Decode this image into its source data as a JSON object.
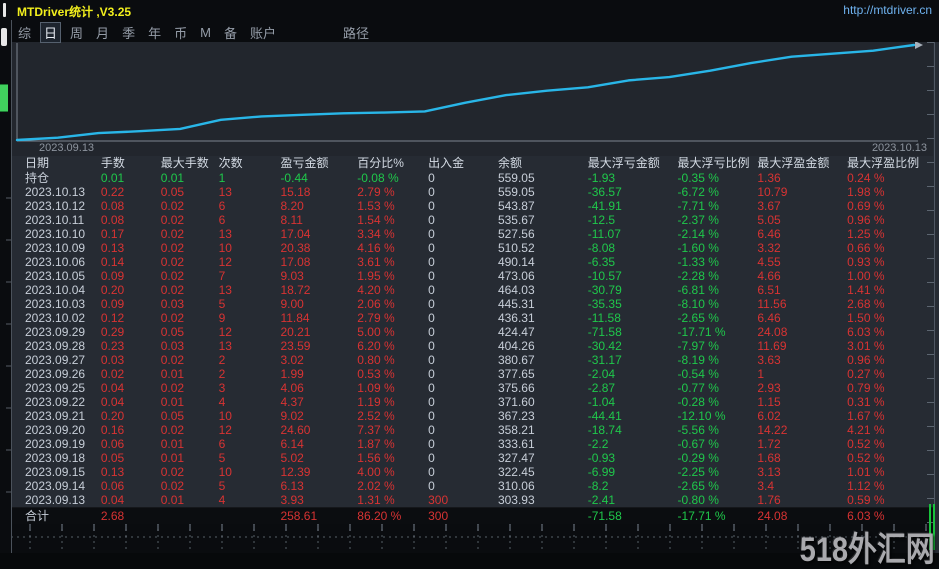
{
  "window": {
    "title": "MTDriver统计 ,V3.25",
    "url": "http://mtdriver.cn",
    "watermark": "518外汇网"
  },
  "menu": {
    "items": [
      "综",
      "日",
      "周",
      "月",
      "季",
      "年",
      "币",
      "M",
      "备",
      "账户"
    ],
    "active": "日",
    "path_label": "路径"
  },
  "palette": {
    "profit_red": "#d83333",
    "loss_green": "#1fc84b",
    "title_yellow": "#f2ef1d",
    "url_blue": "#6fb3f0",
    "line_cyan": "#29b6e8"
  },
  "chart_data": {
    "type": "line",
    "title": "",
    "legend": [],
    "x_start_label": "2023.09.13",
    "x_end_label": "2023.10.13",
    "x": [
      "2023.09.13",
      "2023.09.14",
      "2023.09.15",
      "2023.09.18",
      "2023.09.19",
      "2023.09.20",
      "2023.09.21",
      "2023.09.22",
      "2023.09.25",
      "2023.09.26",
      "2023.09.27",
      "2023.09.28",
      "2023.09.29",
      "2023.10.02",
      "2023.10.03",
      "2023.10.04",
      "2023.10.05",
      "2023.10.06",
      "2023.10.09",
      "2023.10.10",
      "2023.10.11",
      "2023.10.12",
      "2023.10.13"
    ],
    "series": [
      {
        "name": "余额",
        "values": [
          303.93,
          310.06,
          322.45,
          327.47,
          333.61,
          358.21,
          367.23,
          371.6,
          375.66,
          377.65,
          380.67,
          404.26,
          424.47,
          436.31,
          445.31,
          464.03,
          473.06,
          490.14,
          510.52,
          527.56,
          535.67,
          543.87,
          559.05
        ]
      }
    ],
    "ylim": [
      300,
      560
    ],
    "grid": false,
    "line_color": "#29b6e8"
  },
  "table": {
    "headers": [
      "日期",
      "手数",
      "最大手数",
      "次数",
      "盈亏金额",
      "百分比%",
      "出入金",
      "余额",
      "最大浮亏金额",
      "最大浮亏比例",
      "最大浮盈金额",
      "最大浮盈比例"
    ],
    "rows": [
      {
        "holding": true,
        "cells": [
          "持仓",
          "0.01",
          "0.01",
          "1",
          "-0.44",
          "-0.08 %",
          "0",
          "559.05",
          "-1.93",
          "-0.35 %",
          "1.36",
          "0.24 %"
        ]
      },
      {
        "cells": [
          "2023.10.13",
          "0.22",
          "0.05",
          "13",
          "15.18",
          "2.79 %",
          "0",
          "559.05",
          "-36.57",
          "-6.72 %",
          "10.79",
          "1.98 %"
        ]
      },
      {
        "cells": [
          "2023.10.12",
          "0.08",
          "0.02",
          "6",
          "8.20",
          "1.53 %",
          "0",
          "543.87",
          "-41.91",
          "-7.71 %",
          "3.67",
          "0.69 %"
        ]
      },
      {
        "cells": [
          "2023.10.11",
          "0.08",
          "0.02",
          "6",
          "8.11",
          "1.54 %",
          "0",
          "535.67",
          "-12.5",
          "-2.37 %",
          "5.05",
          "0.96 %"
        ]
      },
      {
        "cells": [
          "2023.10.10",
          "0.17",
          "0.02",
          "13",
          "17.04",
          "3.34 %",
          "0",
          "527.56",
          "-11.07",
          "-2.14 %",
          "6.46",
          "1.25 %"
        ]
      },
      {
        "cells": [
          "2023.10.09",
          "0.13",
          "0.02",
          "10",
          "20.38",
          "4.16 %",
          "0",
          "510.52",
          "-8.08",
          "-1.60 %",
          "3.32",
          "0.66 %"
        ]
      },
      {
        "cells": [
          "2023.10.06",
          "0.14",
          "0.02",
          "12",
          "17.08",
          "3.61 %",
          "0",
          "490.14",
          "-6.35",
          "-1.33 %",
          "4.55",
          "0.93 %"
        ]
      },
      {
        "cells": [
          "2023.10.05",
          "0.09",
          "0.02",
          "7",
          "9.03",
          "1.95 %",
          "0",
          "473.06",
          "-10.57",
          "-2.28 %",
          "4.66",
          "1.00 %"
        ]
      },
      {
        "cells": [
          "2023.10.04",
          "0.20",
          "0.02",
          "13",
          "18.72",
          "4.20 %",
          "0",
          "464.03",
          "-30.79",
          "-6.81 %",
          "6.51",
          "1.41 %"
        ]
      },
      {
        "cells": [
          "2023.10.03",
          "0.09",
          "0.03",
          "5",
          "9.00",
          "2.06 %",
          "0",
          "445.31",
          "-35.35",
          "-8.10 %",
          "11.56",
          "2.68 %"
        ]
      },
      {
        "cells": [
          "2023.10.02",
          "0.12",
          "0.02",
          "9",
          "11.84",
          "2.79 %",
          "0",
          "436.31",
          "-11.58",
          "-2.65 %",
          "6.46",
          "1.50 %"
        ]
      },
      {
        "cells": [
          "2023.09.29",
          "0.29",
          "0.05",
          "12",
          "20.21",
          "5.00 %",
          "0",
          "424.47",
          "-71.58",
          "-17.71 %",
          "24.08",
          "6.03 %"
        ]
      },
      {
        "cells": [
          "2023.09.28",
          "0.23",
          "0.03",
          "13",
          "23.59",
          "6.20 %",
          "0",
          "404.26",
          "-30.42",
          "-7.97 %",
          "11.69",
          "3.01 %"
        ]
      },
      {
        "cells": [
          "2023.09.27",
          "0.03",
          "0.02",
          "2",
          "3.02",
          "0.80 %",
          "0",
          "380.67",
          "-31.17",
          "-8.19 %",
          "3.63",
          "0.96 %"
        ]
      },
      {
        "cells": [
          "2023.09.26",
          "0.02",
          "0.01",
          "2",
          "1.99",
          "0.53 %",
          "0",
          "377.65",
          "-2.04",
          "-0.54 %",
          "1",
          "0.27 %"
        ]
      },
      {
        "cells": [
          "2023.09.25",
          "0.04",
          "0.02",
          "3",
          "4.06",
          "1.09 %",
          "0",
          "375.66",
          "-2.87",
          "-0.77 %",
          "2.93",
          "0.79 %"
        ]
      },
      {
        "cells": [
          "2023.09.22",
          "0.04",
          "0.01",
          "4",
          "4.37",
          "1.19 %",
          "0",
          "371.60",
          "-1.04",
          "-0.28 %",
          "1.15",
          "0.31 %"
        ]
      },
      {
        "cells": [
          "2023.09.21",
          "0.20",
          "0.05",
          "10",
          "9.02",
          "2.52 %",
          "0",
          "367.23",
          "-44.41",
          "-12.10 %",
          "6.02",
          "1.67 %"
        ]
      },
      {
        "cells": [
          "2023.09.20",
          "0.16",
          "0.02",
          "12",
          "24.60",
          "7.37 %",
          "0",
          "358.21",
          "-18.74",
          "-5.56 %",
          "14.22",
          "4.21 %"
        ]
      },
      {
        "cells": [
          "2023.09.19",
          "0.06",
          "0.01",
          "6",
          "6.14",
          "1.87 %",
          "0",
          "333.61",
          "-2.2",
          "-0.67 %",
          "1.72",
          "0.52 %"
        ]
      },
      {
        "cells": [
          "2023.09.18",
          "0.05",
          "0.01",
          "5",
          "5.02",
          "1.56 %",
          "0",
          "327.47",
          "-0.93",
          "-0.29 %",
          "1.68",
          "0.52 %"
        ]
      },
      {
        "cells": [
          "2023.09.15",
          "0.13",
          "0.02",
          "10",
          "12.39",
          "4.00 %",
          "0",
          "322.45",
          "-6.99",
          "-2.25 %",
          "3.13",
          "1.01 %"
        ]
      },
      {
        "cells": [
          "2023.09.14",
          "0.06",
          "0.02",
          "5",
          "6.13",
          "2.02 %",
          "0",
          "310.06",
          "-8.2",
          "-2.65 %",
          "3.4",
          "1.12 %"
        ]
      },
      {
        "cells": [
          "2023.09.13",
          "0.04",
          "0.01",
          "4",
          "3.93",
          "1.31 %",
          "300",
          "303.93",
          "-2.41",
          "-0.80 %",
          "1.76",
          "0.59 %"
        ]
      },
      {
        "total": true,
        "cells": [
          "合计",
          "2.68",
          "",
          "",
          "258.61",
          "86.20 %",
          "300",
          "",
          "-71.58",
          "-17.71 %",
          "24.08",
          "6.03 %"
        ]
      }
    ]
  }
}
